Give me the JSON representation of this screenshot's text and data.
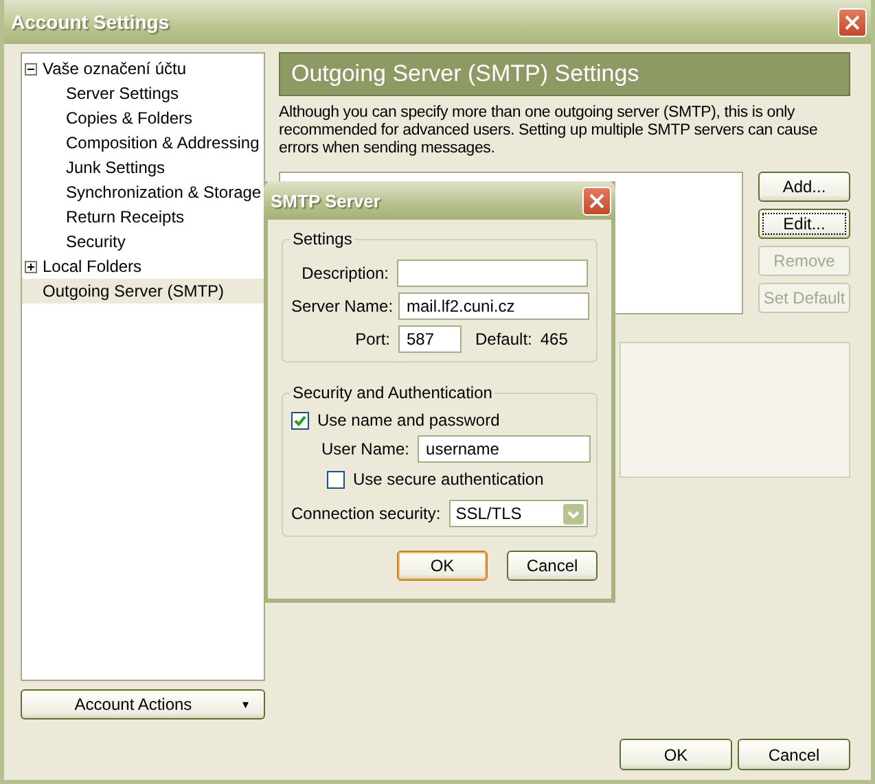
{
  "window": {
    "title": "Account Settings"
  },
  "tree": [
    {
      "label": "Vaše označení účtu",
      "expanded": true,
      "selected": false,
      "children": [
        {
          "label": "Server Settings",
          "selected": false
        },
        {
          "label": "Copies & Folders",
          "selected": false
        },
        {
          "label": "Composition & Addressing",
          "selected": false
        },
        {
          "label": "Junk Settings",
          "selected": false
        },
        {
          "label": "Synchronization & Storage",
          "selected": false
        },
        {
          "label": "Return Receipts",
          "selected": false
        },
        {
          "label": "Security",
          "selected": false
        }
      ]
    },
    {
      "label": "Local Folders",
      "expanded": false,
      "selected": false
    },
    {
      "label": "Outgoing Server (SMTP)",
      "selected": true
    }
  ],
  "account_actions": {
    "label": "Account Actions",
    "caret": "▾"
  },
  "panel": {
    "title": "Outgoing Server (SMTP) Settings",
    "description": "Although you can specify more than one outgoing server (SMTP), this is only recommended for advanced users. Setting up multiple SMTP servers can cause errors when sending messages.",
    "buttons": [
      {
        "label": "Add...",
        "disabled": false,
        "focused": false
      },
      {
        "label": "Edit...",
        "disabled": false,
        "focused": true
      },
      {
        "label": "Remove",
        "disabled": true,
        "focused": false
      },
      {
        "label": "Set Default",
        "disabled": true,
        "focused": false
      }
    ]
  },
  "dialog": {
    "title": "SMTP Server",
    "settings": {
      "legend": "Settings",
      "description_label": "Description:",
      "server_label": "Server Name:",
      "server_value": "mail.lf2.cuni.cz",
      "port_label": "Port:",
      "port_value": "587",
      "default_label": "Default:",
      "default_value": "465"
    },
    "security": {
      "legend": "Security and Authentication",
      "use_password": {
        "label": "Use name and password",
        "checked": true
      },
      "username_label": "User Name:",
      "username_value": "username",
      "secure_auth": {
        "label": "Use secure authentication",
        "checked": false
      },
      "connection_label": "Connection security:",
      "connection_value": "SSL/TLS"
    },
    "buttons": [
      {
        "label": "OK",
        "default": true
      },
      {
        "label": "Cancel",
        "default": false
      }
    ]
  },
  "buttons": [
    {
      "label": "OK"
    },
    {
      "label": "Cancel"
    }
  ]
}
